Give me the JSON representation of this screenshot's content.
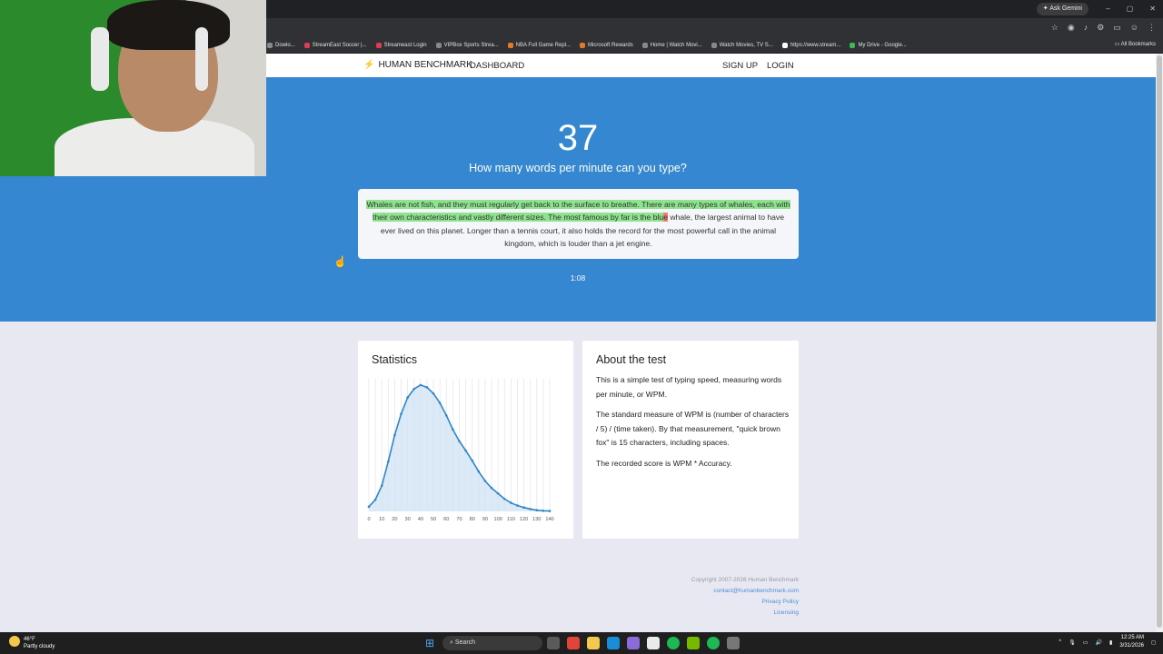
{
  "browser": {
    "gemini_label": "Ask Gemini",
    "window_controls": [
      "–",
      "▢",
      "✕"
    ],
    "bookmarks": [
      {
        "label": "Dowlo...",
        "color": "#888888"
      },
      {
        "label": "StreamEast Soccer |...",
        "color": "#e03c5a"
      },
      {
        "label": "Streameast Login",
        "color": "#e03c5a"
      },
      {
        "label": "VIPBox Sports Strea...",
        "color": "#888888"
      },
      {
        "label": "NBA Full Game Repl...",
        "color": "#e07a2a"
      },
      {
        "label": "Microsoft Rewards",
        "color": "#e07a2a"
      },
      {
        "label": "Home | Watch Movi...",
        "color": "#888888"
      },
      {
        "label": "Watch Movies, TV S...",
        "color": "#888888"
      },
      {
        "label": "https://www.stream...",
        "color": "#ffffff"
      },
      {
        "label": "My Drive - Google...",
        "color": "#3cba54"
      }
    ],
    "all_bookmarks": "All Bookmarks"
  },
  "nav": {
    "brand": "HUMAN BENCHMARK",
    "dashboard": "DASHBOARD",
    "signup": "SIGN UP",
    "login": "LOGIN"
  },
  "hero": {
    "wpm": "37",
    "question": "How many words per minute can you type?",
    "typed_text": "Whales are not fish, and they must regularly get back to the surface to breathe. There are many types of whales, each with their own characteristics and vastly different sizes. The most famous by far is the blu",
    "current_char": "e",
    "space_char": " ",
    "remaining_text": "whale, the largest animal to have ever lived on this planet. Longer than a tennis court, it also holds the record for the most powerful call in the animal kingdom, which is louder than a jet engine.",
    "timer": "1:08"
  },
  "statistics": {
    "title": "Statistics"
  },
  "about": {
    "title": "About the test",
    "p1": "This is a simple test of typing speed, measuring words per minute, or WPM.",
    "p2": "The standard measure of WPM is (number of characters / 5) / (time taken). By that measurement, \"quick brown fox\" is 15 characters, including spaces.",
    "p3": "The recorded score is WPM * Accuracy."
  },
  "footer": {
    "copyright": "Copyright 2007-2026 Human Benchmark",
    "email": "contact@humanbenchmark.com",
    "privacy": "Privacy Policy",
    "licensing": "Licensing"
  },
  "taskbar": {
    "temp": "46°F",
    "weather": "Partly cloudy",
    "search": "Search",
    "time": "12:25 AM",
    "date": "3/31/2026"
  },
  "chart_data": {
    "type": "area",
    "x": [
      0,
      5,
      10,
      15,
      20,
      25,
      30,
      35,
      40,
      45,
      50,
      55,
      60,
      65,
      70,
      75,
      80,
      85,
      90,
      95,
      100,
      105,
      110,
      115,
      120,
      125,
      130,
      135,
      140
    ],
    "y": [
      0.6,
      1.5,
      3.3,
      6.4,
      9.8,
      12.5,
      14.6,
      15.7,
      16.2,
      15.9,
      15.1,
      13.9,
      12.3,
      10.5,
      9.0,
      7.8,
      6.5,
      5.1,
      3.9,
      3.0,
      2.3,
      1.6,
      1.1,
      0.75,
      0.5,
      0.3,
      0.15,
      0.08,
      0.05
    ],
    "xticks": [
      "0",
      "10",
      "20",
      "30",
      "40",
      "50",
      "60",
      "70",
      "80",
      "90",
      "100",
      "110",
      "120",
      "130",
      "140"
    ],
    "xlim": [
      0,
      140
    ],
    "ylim": [
      0,
      17
    ],
    "color": "#2f86c9",
    "fill": "#cfe3f3",
    "grid": true
  }
}
